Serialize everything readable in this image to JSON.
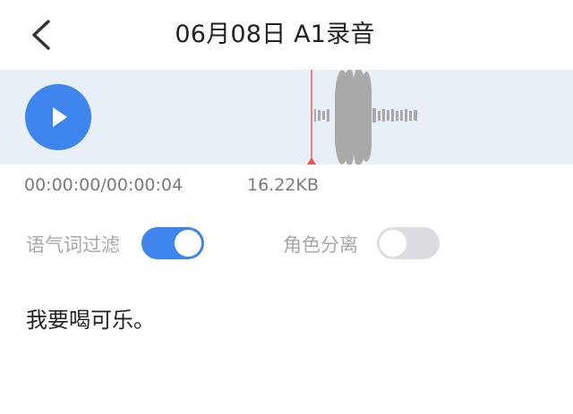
{
  "header": {
    "title": "06月08日 A1录音",
    "back_icon": "chevron-left-icon"
  },
  "player": {
    "play_icon": "play-icon",
    "accent_color": "#3e86ee",
    "playhead_color": "#e8574f",
    "waveform_color": "#a9a9a9"
  },
  "info": {
    "duration": "00:00:00/00:00:04",
    "file_size": "16.22KB"
  },
  "toggles": {
    "filter_label": "语气词过滤",
    "filter_on": true,
    "role_label": "角色分离",
    "role_on": false
  },
  "transcript": {
    "text": "我要喝可乐。"
  }
}
